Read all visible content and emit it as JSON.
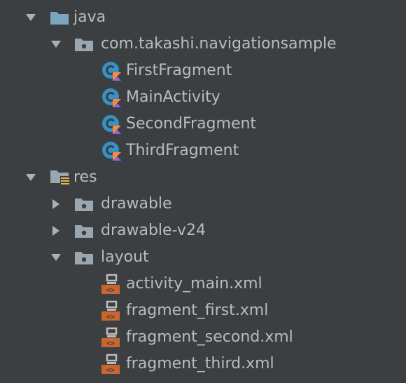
{
  "colors": {
    "background": "#3c3f41",
    "text": "#bbbbbb",
    "arrow": "#a9b1b6",
    "folder_gray": "#9aa7b0",
    "folder_blue": "#7aa6c2",
    "kotlin_class": "#3592c4",
    "kotlin_k_orange": "#f88a3b",
    "kotlin_k_purple": "#9063e8",
    "xml_layout": "#c8662f"
  },
  "tree": {
    "java": {
      "label": "java",
      "arrow": "expanded",
      "icon": "source-folder-icon"
    },
    "package": {
      "label": "com.takashi.navigationsample",
      "arrow": "expanded",
      "icon": "package-icon",
      "files": [
        {
          "label": "FirstFragment",
          "icon": "kotlin-class-icon"
        },
        {
          "label": "MainActivity",
          "icon": "kotlin-class-icon"
        },
        {
          "label": "SecondFragment",
          "icon": "kotlin-class-icon"
        },
        {
          "label": "ThirdFragment",
          "icon": "kotlin-class-icon"
        }
      ]
    },
    "res": {
      "label": "res",
      "arrow": "expanded",
      "icon": "resource-folder-icon"
    },
    "drawable": {
      "label": "drawable",
      "arrow": "collapsed",
      "icon": "folder-icon"
    },
    "drawable_v24": {
      "label": "drawable-v24",
      "arrow": "collapsed",
      "icon": "folder-icon"
    },
    "layout": {
      "label": "layout",
      "arrow": "expanded",
      "icon": "folder-icon",
      "files": [
        {
          "label": "activity_main.xml",
          "icon": "layout-xml-icon"
        },
        {
          "label": "fragment_first.xml",
          "icon": "layout-xml-icon"
        },
        {
          "label": "fragment_second.xml",
          "icon": "layout-xml-icon"
        },
        {
          "label": "fragment_third.xml",
          "icon": "layout-xml-icon"
        }
      ]
    }
  }
}
